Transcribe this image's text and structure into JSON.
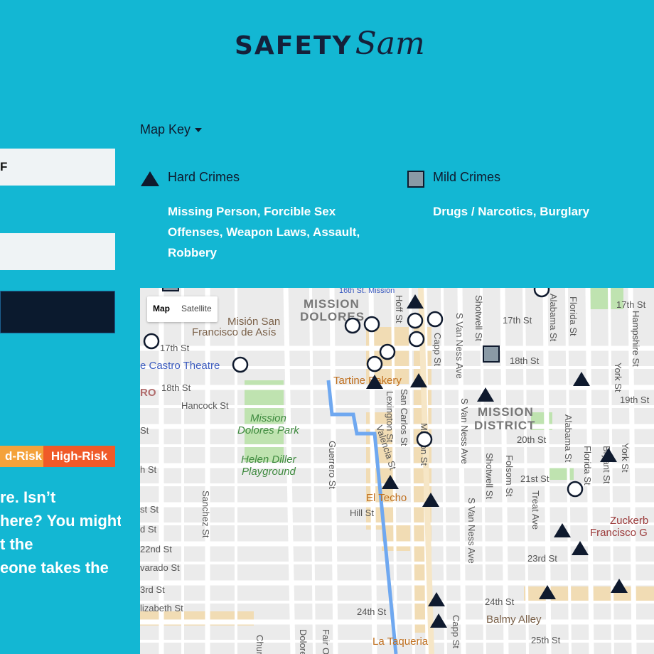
{
  "logo": {
    "bold": "SAFETY",
    "script": "Sam"
  },
  "panel": {
    "input_value": "F",
    "risk_mid": "d-Risk",
    "risk_high": "High-Risk",
    "blurb_lines": [
      "re. Isn’t",
      "here? You might",
      "t the",
      "eone takes the"
    ]
  },
  "map_key": {
    "toggle_label": "Map Key",
    "hard": {
      "title": "Hard Crimes",
      "desc": "Missing Person, Forcible Sex Offenses, Weapon Laws, Assault, Robbery"
    },
    "mild": {
      "title": "Mild Crimes",
      "desc": "Drugs / Narcotics, Burglary"
    }
  },
  "map": {
    "type_map": "Map",
    "type_satellite": "Satellite",
    "labels": {
      "mission_dolores": "MISSION",
      "mission_dolores_2": "DOLORES",
      "mission_district": "MISSION",
      "mission_district_2": "DISTRICT",
      "mision_san": "Misión San",
      "francisco_asis": "Francisco de Asís",
      "castro_theatre": "e Castro Theatre",
      "tartine": "Tartine Bakery",
      "el_techo": "El Techo",
      "la_taqueria": "La Taqueria",
      "balmy_alley": "Balmy Alley",
      "dolores_park": "Mission",
      "dolores_park_2": "Dolores Park",
      "helen_diller": "Helen Diller",
      "helen_diller_2": "Playground",
      "zuckerberg": "Zuckerb",
      "zuckerberg_2": "Francisco G",
      "16th_mission": "16th St. Mission",
      "ro": "RO"
    },
    "streets": {
      "s17_a": "17th St",
      "s17_b": "17th St",
      "s17_c": "17th St",
      "s18_a": "18th St",
      "s18_b": "18th St",
      "s19": "19th St",
      "s20": "20th St",
      "s21": "21st St",
      "s22": "22nd St",
      "s23": "23rd St",
      "s24_a": "24th St",
      "s24_b": "24th St",
      "s25": "25th St",
      "hancock": "Hancock St",
      "hill": "Hill St",
      "alvarado": "varado St",
      "elizabeth": "lizabeth St",
      "st_a": "St",
      "st_b": "h St",
      "st_c": "st St",
      "st_d": "d St",
      "st_e": "2nd St",
      "st_f": "3rd St",
      "guerrero": "Guerrero St",
      "valencia": "Valencia St",
      "lexington": "Lexington St",
      "san_carlos": "San Carlos St",
      "mission": "Mission St",
      "capp_a": "Capp St",
      "capp_b": "Capp St",
      "s_van_ness_a": "S Van Ness Ave",
      "s_van_ness_b": "S Van Ness Ave",
      "s_van_ness_c": "S Van Ness Ave",
      "shotwell_a": "Shotwell St",
      "shotwell_b": "Shotwell St",
      "folsom": "Folsom St",
      "treat": "Treat Ave",
      "alabama_a": "Alabama St",
      "alabama_b": "Alabama St",
      "florida_a": "Florida St",
      "florida_b": "Florida St",
      "bryant": "Bryant St",
      "york_a": "York St",
      "york_b": "York St",
      "hampshire": "Hampshire St",
      "hoff": "Hoff St",
      "sanchez": "Sanchez St",
      "dolores": "Dolore",
      "fair_oaks": "Fair O",
      "church": "Chur"
    }
  }
}
